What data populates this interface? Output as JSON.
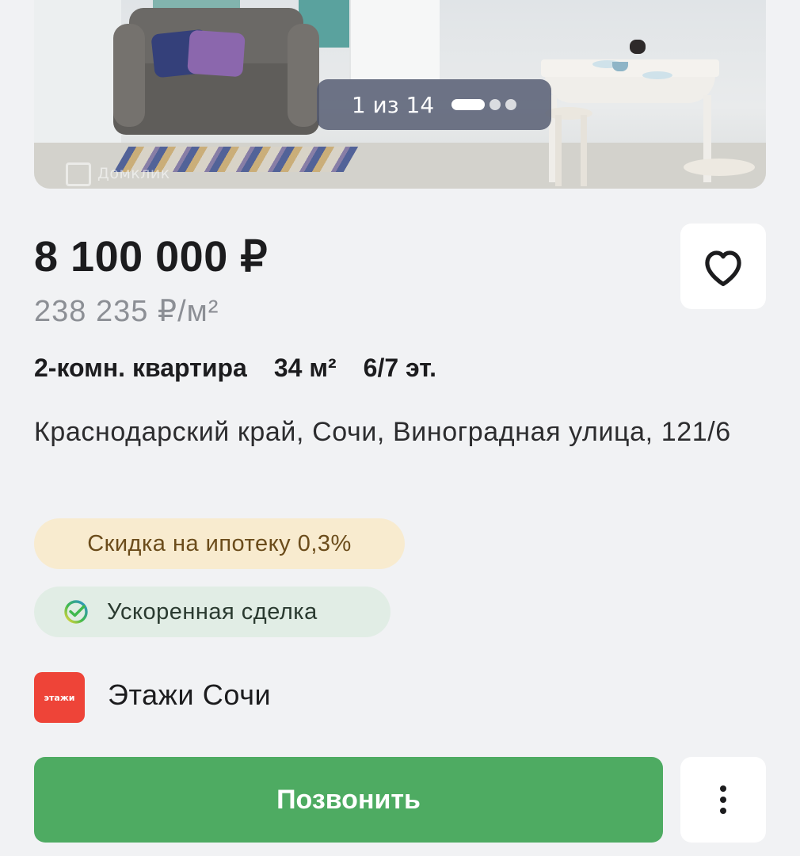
{
  "gallery": {
    "counter_text": "1 из 14",
    "current_index": 1,
    "total": 14,
    "watermark": "Домклик"
  },
  "listing": {
    "price": "8 100 000 ₽",
    "price_per_sqm": "238 235 ₽/м²",
    "rooms": "2-комн. квартира",
    "area": "34 м²",
    "floor": "6/7 эт.",
    "address": "Краснодарский край, Сочи, Виноградная улица, 121/6"
  },
  "tags": {
    "discount": "Скидка на ипотеку 0,3%",
    "fast_deal": "Ускоренная сделка"
  },
  "agency": {
    "logo_text": "этажи",
    "name": "Этажи Сочи"
  },
  "actions": {
    "call_label": "Позвонить",
    "favorite_icon": "heart-outline-icon",
    "more_icon": "vertical-dots-icon"
  },
  "colors": {
    "call_button": "#4eab62",
    "agency_logo": "#ee4438",
    "discount_chip": "#f8ebcf",
    "deal_chip": "#e1ede5"
  }
}
